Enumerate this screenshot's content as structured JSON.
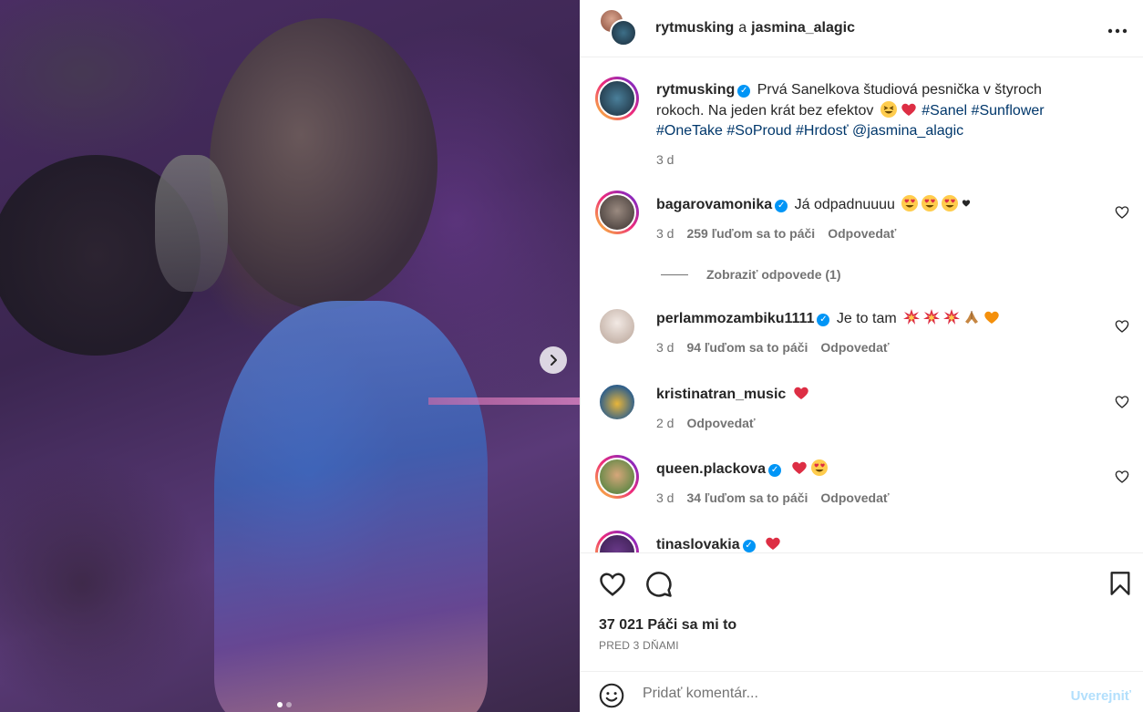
{
  "header": {
    "user1": "rytmusking",
    "conjunction": "a",
    "user2": "jasmina_alagic"
  },
  "caption": {
    "username": "rytmusking",
    "text": "Prvá Sanelkova študiová pesnička v štyroch rokoch. Na jeden krát bez efektov",
    "hashtags": [
      "#Sanel",
      "#Sunflower",
      "#OneTake",
      "#SoProud",
      "#Hrdosť",
      "@jasmina_alagic"
    ],
    "time": "3 d"
  },
  "comments": [
    {
      "username": "bagarovamonika",
      "verified": true,
      "text": "Já odpadnuuuu",
      "emojis": [
        "heart-eyes",
        "heart-eyes",
        "heart-eyes",
        "black-heart"
      ],
      "time": "3 d",
      "likes": "259 ľuďom sa to páči",
      "reply": "Odpovedať"
    },
    {
      "username": "perlammozambiku1111",
      "verified": true,
      "text": "Je to tam",
      "emojis": [
        "collision",
        "collision",
        "collision",
        "folded-hands",
        "orange-heart"
      ],
      "time": "3 d",
      "likes": "94 ľuďom sa to páči",
      "reply": "Odpovedať"
    },
    {
      "username": "kristinatran_music",
      "verified": false,
      "text": "",
      "emojis": [
        "red-heart"
      ],
      "time": "2 d",
      "likes": "",
      "reply": "Odpovedať"
    },
    {
      "username": "queen.plackova",
      "verified": true,
      "text": "",
      "emojis": [
        "red-heart",
        "heart-eyes"
      ],
      "time": "3 d",
      "likes": "34 ľuďom sa to páči",
      "reply": "Odpovedať"
    },
    {
      "username": "tinaslovakia",
      "verified": true,
      "text": "",
      "emojis": [
        "red-heart"
      ]
    }
  ],
  "view_replies": "Zobraziť odpovede (1)",
  "likes_count": "37 021 Páči sa mi to",
  "posted_ago": "PRED 3 DŇAMI",
  "comment_box": {
    "placeholder": "Pridať komentár...",
    "post_label": "Uverejniť"
  },
  "carousel": {
    "current": 1,
    "total": 2
  }
}
